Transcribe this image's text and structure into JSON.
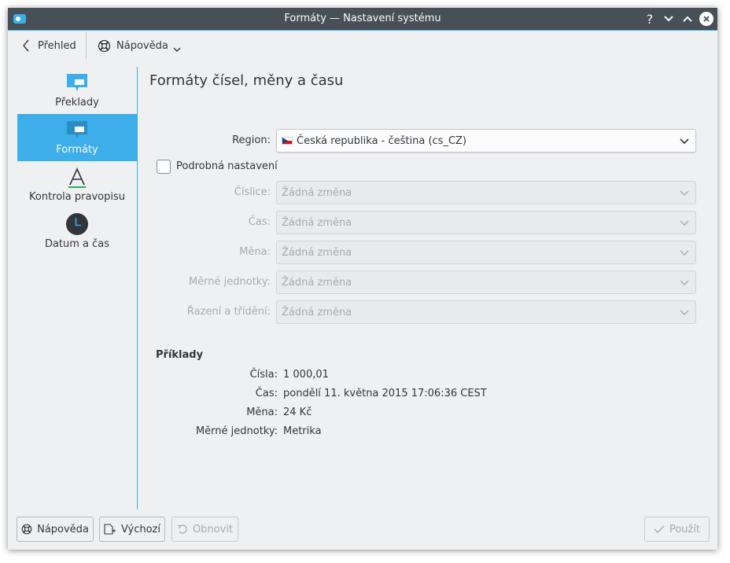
{
  "window": {
    "title": "Formáty  — Nastavení systému",
    "controls": {
      "help": "?",
      "minimize": "⌄",
      "maximize": "⌃",
      "close": "✕"
    }
  },
  "toolbar": {
    "back_label": "Přehled",
    "help_label": "Nápověda"
  },
  "sidebar": {
    "items": [
      {
        "label": "Překlady",
        "icon": "speech-bubble-icon",
        "active": false
      },
      {
        "label": "Formáty",
        "icon": "speech-bubble-icon",
        "active": true
      },
      {
        "label": "Kontrola pravopisu",
        "icon": "spellcheck-icon",
        "active": false
      },
      {
        "label": "Datum a čas",
        "icon": "clock-icon",
        "active": false
      }
    ]
  },
  "main": {
    "title": "Formáty čísel, měny a času",
    "region": {
      "label": "Region:",
      "value": "Česká republika - čeština (cs_CZ)",
      "flag": "cz-flag-icon"
    },
    "detailed": {
      "label": "Podrobná nastavení",
      "checked": false
    },
    "settings": [
      {
        "label": "Číslice:",
        "value": "Žádná změna"
      },
      {
        "label": "Čas:",
        "value": "Žádná změna"
      },
      {
        "label": "Měna:",
        "value": "Žádná změna"
      },
      {
        "label": "Měrné jednotky:",
        "value": "Žádná změna"
      },
      {
        "label": "Řazení a třídění:",
        "value": "Žádná změna"
      }
    ],
    "examples": {
      "title": "Příklady",
      "rows": [
        {
          "label": "Čísla:",
          "value": "1 000,01"
        },
        {
          "label": "Čas:",
          "value": "pondělí 11. května 2015 17:06:36 CEST"
        },
        {
          "label": "Měna:",
          "value": "24 Kč"
        },
        {
          "label": "Měrné jednotky:",
          "value": "Metrika"
        }
      ]
    }
  },
  "buttons": {
    "help": "Nápověda",
    "defaults": "Výchozí",
    "reset": "Obnovit",
    "apply": "Použít"
  },
  "colors": {
    "accent": "#3daee9",
    "titlebar": "#475057",
    "window_bg": "#eff0f1",
    "text": "#31363b",
    "disabled_text": "#a8abad"
  }
}
